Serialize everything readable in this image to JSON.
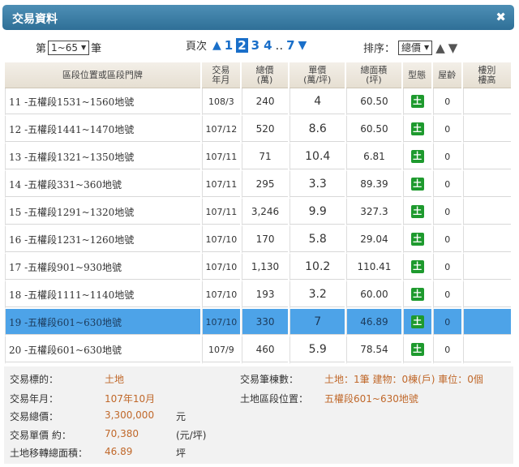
{
  "window": {
    "title": "交易資料",
    "close_glyph": "✖"
  },
  "pager": {
    "prefix": "第",
    "range": "1~65",
    "suffix": "筆",
    "page_label": "頁次",
    "pages": [
      "1",
      "2",
      "3",
      "4"
    ],
    "active_page": "2",
    "dots": "..",
    "last_page": "7"
  },
  "sort": {
    "label": "排序：",
    "value": "總價"
  },
  "columns": [
    "區段位置或區段門牌",
    "交易年月",
    "總價(萬)",
    "單價(萬/坪)",
    "總面積(坪)",
    "型態",
    "屋齡",
    "樓別樓高"
  ],
  "column_lines": [
    [
      "區段位置或區段門牌"
    ],
    [
      "交易",
      "年月"
    ],
    [
      "總價",
      "(萬)"
    ],
    [
      "單價",
      "(萬/坪)"
    ],
    [
      "總面積",
      "(坪)"
    ],
    [
      "型態"
    ],
    [
      "屋齡"
    ],
    [
      "樓別",
      "樓高"
    ]
  ],
  "rows": [
    {
      "loc": "11 -五權段1531~1560地號",
      "ym": "108/3",
      "total": "240",
      "unit": "4",
      "area": "60.50",
      "type": "土",
      "age": "0"
    },
    {
      "loc": "12 -五權段1441~1470地號",
      "ym": "107/12",
      "total": "520",
      "unit": "8.6",
      "area": "60.50",
      "type": "土",
      "age": "0"
    },
    {
      "loc": "13 -五權段1321~1350地號",
      "ym": "107/11",
      "total": "71",
      "unit": "10.4",
      "area": "6.81",
      "type": "土",
      "age": "0"
    },
    {
      "loc": "14 -五權段331~360地號",
      "ym": "107/11",
      "total": "295",
      "unit": "3.3",
      "area": "89.39",
      "type": "土",
      "age": "0"
    },
    {
      "loc": "15 -五權段1291~1320地號",
      "ym": "107/11",
      "total": "3,246",
      "unit": "9.9",
      "area": "327.3",
      "type": "土",
      "age": "0"
    },
    {
      "loc": "16 -五權段1231~1260地號",
      "ym": "107/10",
      "total": "170",
      "unit": "5.8",
      "area": "29.04",
      "type": "土",
      "age": "0"
    },
    {
      "loc": "17 -五權段901~930地號",
      "ym": "107/10",
      "total": "1,130",
      "unit": "10.2",
      "area": "110.41",
      "type": "土",
      "age": "0"
    },
    {
      "loc": "18 -五權段1111~1140地號",
      "ym": "107/10",
      "total": "193",
      "unit": "3.2",
      "area": "60.00",
      "type": "土",
      "age": "0"
    },
    {
      "loc": "19 -五權段601~630地號",
      "ym": "107/10",
      "total": "330",
      "unit": "7",
      "area": "46.89",
      "type": "土",
      "age": "0",
      "selected": true
    },
    {
      "loc": "20 -五權段601~630地號",
      "ym": "107/9",
      "total": "460",
      "unit": "5.9",
      "area": "78.54",
      "type": "土",
      "age": "0"
    }
  ],
  "detail": {
    "target_label": "交易標的：",
    "target_value": "土地",
    "ym_label": "交易年月：",
    "ym_value": "107年10月",
    "total_label": "交易總價：",
    "total_value": "3,300,000",
    "total_unit": "元",
    "unit_label": "交易單價 約：",
    "unit_value": "70,380",
    "unit_unit": "(元/坪)",
    "area_label": "土地移轉總面積：",
    "area_value": "46.89",
    "area_unit": "坪",
    "count_label": "交易筆棟數：",
    "count_value": "土地：1筆 建物：0棟(戶) 車位：0個",
    "section_label": "土地區段位置：",
    "section_value": "五權段601~630地號"
  },
  "colors": {
    "titlebar": "#3a7ca5",
    "accent": "#1a6fc9",
    "selected_row": "#4da3e8",
    "type_badge": "#1e9a2e",
    "detail_value": "#c0682a"
  }
}
